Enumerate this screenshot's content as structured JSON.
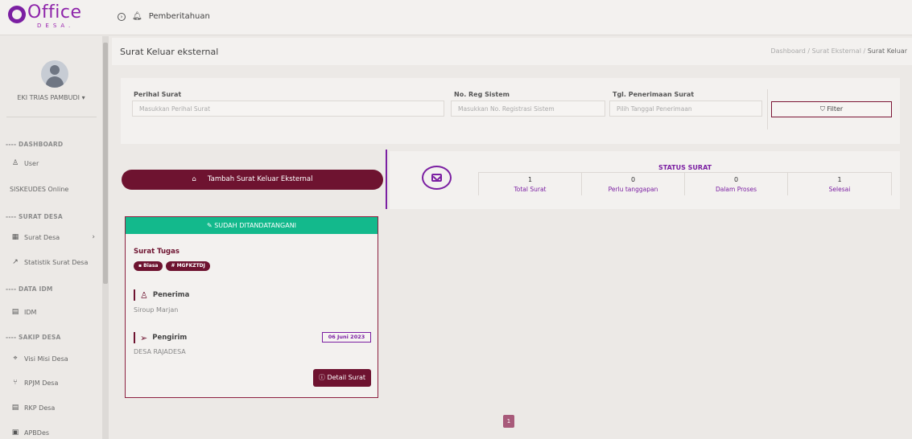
{
  "brand": {
    "name": "Office",
    "sub": "DESA."
  },
  "topbar": {
    "nav_icon": "circle-arrow-icon",
    "notifications_label": "Pemberitahuan"
  },
  "user": {
    "name": "EKI TRIAS PAMBUDI ▾"
  },
  "sidebar": {
    "sections": [
      {
        "header": "---- DASHBOARD"
      },
      {
        "header": "---- SURAT DESA"
      },
      {
        "header": "---- DATA IDM"
      },
      {
        "header": "---- SAKIP DESA"
      }
    ],
    "items": {
      "user": "User",
      "siskeudes": "SISKEUDES Online",
      "surat_desa": "Surat Desa",
      "statistik": "Statistik Surat Desa",
      "idm": "IDM",
      "visi_misi": "Visi Misi Desa",
      "rpjm": "RPJM Desa",
      "rkp": "RKP Desa",
      "apbdes": "APBDes"
    }
  },
  "page": {
    "title": "Surat Keluar eksternal",
    "breadcrumb": {
      "dashboard": "Dashboard",
      "sep": " / ",
      "eksternal": "Surat Eksternal",
      "current": "Surat Keluar"
    }
  },
  "filter": {
    "perihal_label": "Perihal Surat",
    "perihal_placeholder": "Masukkan Perihal Surat",
    "noreg_label": "No. Reg Sistem",
    "noreg_placeholder": "Masukkan No. Registrasi Sistem",
    "tgl_label": "Tgl. Penerimaan Surat",
    "tgl_placeholder": "Pilih Tanggal Penerimaan",
    "filter_button": "Filter"
  },
  "add_button": "Tambah Surat Keluar Eksternal",
  "status": {
    "title": "STATUS SURAT",
    "cells": [
      {
        "num": "1",
        "label": "Total Surat"
      },
      {
        "num": "0",
        "label": "Perlu tanggapan"
      },
      {
        "num": "0",
        "label": "Dalam Proses"
      },
      {
        "num": "1",
        "label": "Selesai"
      }
    ]
  },
  "card": {
    "header": "SUDAH DITANDATANGANI",
    "title": "Surat Tugas",
    "badges": [
      "Biasa",
      "# MGFKZTDJ"
    ],
    "penerima_label": "Penerima",
    "penerima_value": "Siroup Marjan",
    "pengirim_label": "Pengirim",
    "pengirim_value": "DESA RAJADESA",
    "date": "06 Juni 2023",
    "detail_button": "Detail Surat"
  },
  "pagination": {
    "current": "1"
  },
  "colors": {
    "primary": "#6e1330",
    "accent": "#7b1fa2",
    "success": "#13b98c"
  }
}
